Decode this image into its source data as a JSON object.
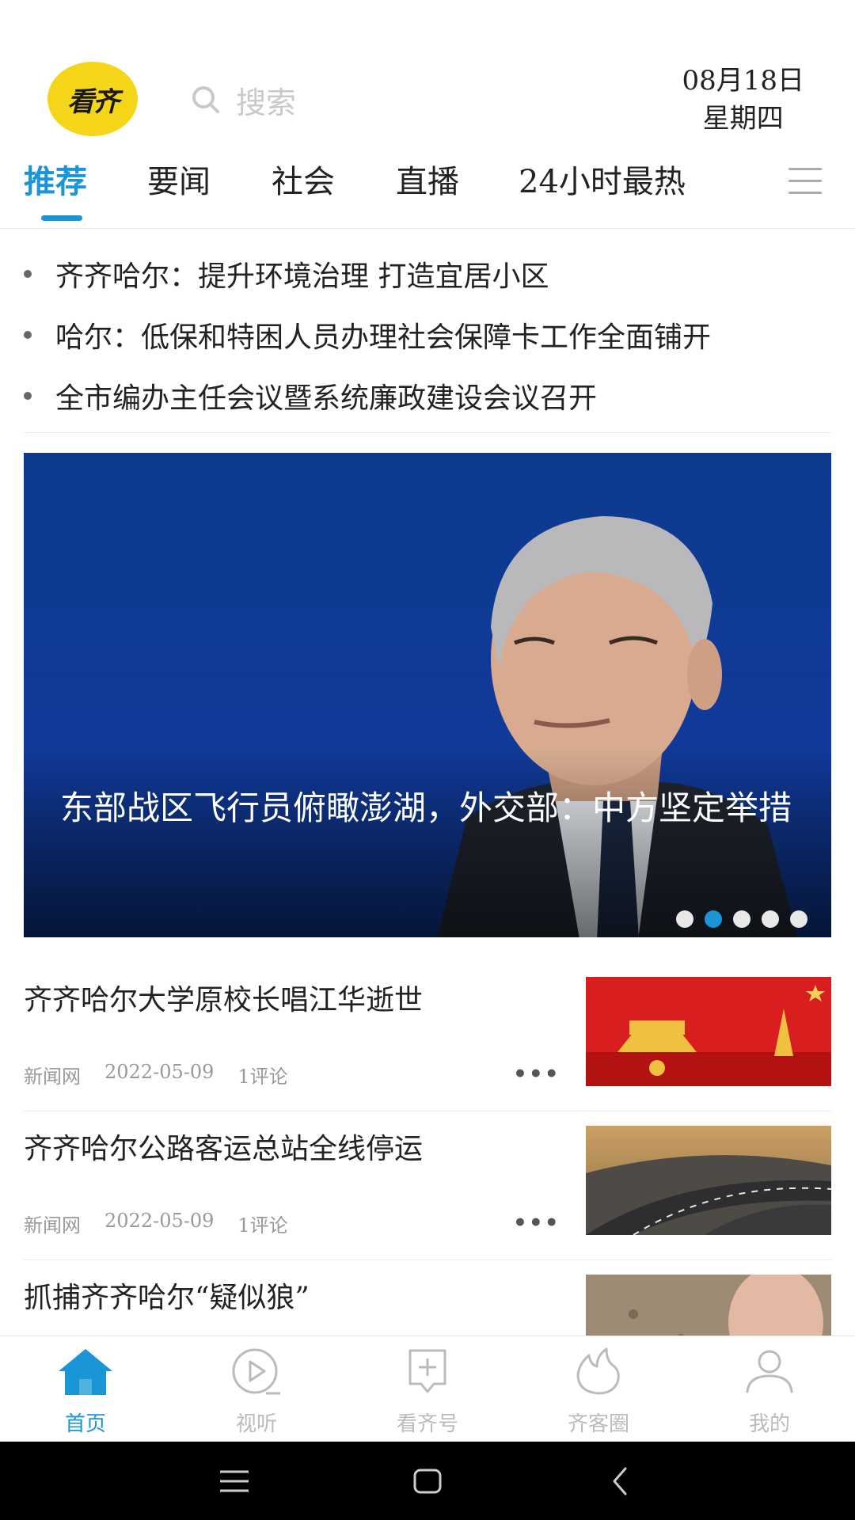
{
  "header": {
    "logo_text": "看齐",
    "search_placeholder": "搜索",
    "date": "08月18日",
    "weekday": "星期四"
  },
  "tabs": [
    {
      "label": "推荐",
      "active": true
    },
    {
      "label": "要闻"
    },
    {
      "label": "社会"
    },
    {
      "label": "直播"
    },
    {
      "label": "24小时最热"
    }
  ],
  "headlines": [
    "齐齐哈尔：提升环境治理 打造宜居小区",
    "哈尔：低保和特困人员办理社会保障卡工作全面铺开",
    "全市编办主任会议暨系统廉政建设会议召开"
  ],
  "banner": {
    "caption": "东部战区飞行员俯瞰澎湖，外交部：中方坚定举措",
    "page_count": 5,
    "active_page": 2
  },
  "news": [
    {
      "title": "齐齐哈尔大学原校长唱江华逝世",
      "source": "新闻网",
      "date": "2022-05-09",
      "comments": "1评论"
    },
    {
      "title": "齐齐哈尔公路客运总站全线停运",
      "source": "新闻网",
      "date": "2022-05-09",
      "comments": "1评论"
    },
    {
      "title": "抓捕齐齐哈尔“疑似狼”"
    }
  ],
  "bottom_nav": [
    {
      "label": "首页",
      "icon": "home-icon",
      "active": true
    },
    {
      "label": "视听",
      "icon": "play-icon"
    },
    {
      "label": "看齐号",
      "icon": "add-square-icon"
    },
    {
      "label": "齐客圈",
      "icon": "flame-icon"
    },
    {
      "label": "我的",
      "icon": "user-icon"
    }
  ],
  "colors": {
    "accent": "#1a95d6",
    "logo_bg": "#f5d51a"
  }
}
